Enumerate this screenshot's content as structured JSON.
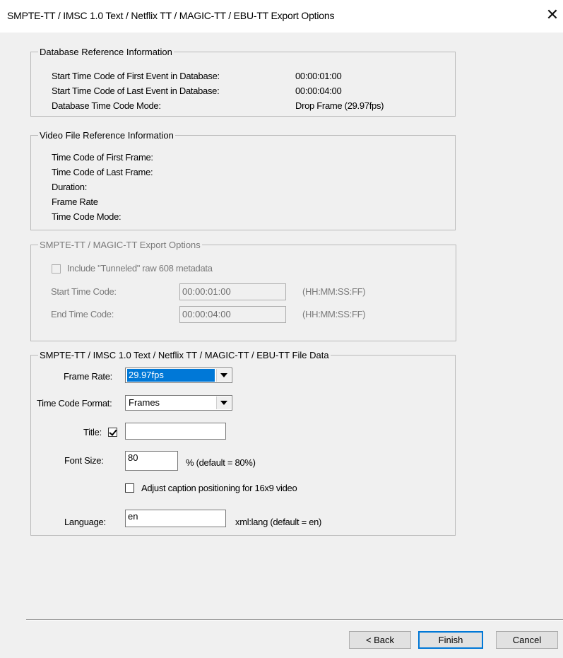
{
  "window": {
    "title": "SMPTE-TT / IMSC 1.0 Text / Netflix TT / MAGIC-TT / EBU-TT Export Options",
    "close_glyph": "✕"
  },
  "db_ref": {
    "legend": "Database Reference Information",
    "rows": [
      {
        "label": "Start Time Code of First Event in Database:",
        "value": "00:00:01:00"
      },
      {
        "label": "Start Time Code of Last Event in Database:",
        "value": "00:00:04:00"
      },
      {
        "label": "Database Time Code Mode:",
        "value": "Drop Frame (29.97fps)"
      }
    ]
  },
  "video_ref": {
    "legend": "Video File Reference Information",
    "rows": [
      {
        "label": "Time Code of First Frame:",
        "value": ""
      },
      {
        "label": "Time Code of Last Frame:",
        "value": ""
      },
      {
        "label": "Duration:",
        "value": ""
      },
      {
        "label": "Frame Rate",
        "value": ""
      },
      {
        "label": "Time Code Mode:",
        "value": ""
      }
    ]
  },
  "export_opts": {
    "legend": "SMPTE-TT / MAGIC-TT Export Options",
    "tunneled_label": "Include \"Tunneled\" raw 608 metadata",
    "tunneled_checked": false,
    "start_label": "Start Time Code:",
    "start_value": "00:00:01:00",
    "start_hint": "(HH:MM:SS:FF)",
    "end_label": "End Time Code:",
    "end_value": "00:00:04:00",
    "end_hint": "(HH:MM:SS:FF)"
  },
  "file_data": {
    "legend": "SMPTE-TT / IMSC 1.0 Text / Netflix TT / MAGIC-TT / EBU-TT File Data",
    "frame_rate_label": "Frame Rate:",
    "frame_rate_value": "29.97fps",
    "tc_format_label": "Time Code Format:",
    "tc_format_value": "Frames",
    "title_label": "Title:",
    "title_checked": true,
    "title_value": "",
    "font_size_label": "Font Size:",
    "font_size_value": "80",
    "font_size_hint": "%  (default = 80%)",
    "adjust_label": "Adjust caption positioning for 16x9 video",
    "adjust_checked": false,
    "language_label": "Language:",
    "language_value": "en",
    "language_hint": "xml:lang  (default = en)"
  },
  "buttons": {
    "back": "< Back",
    "finish": "Finish",
    "cancel": "Cancel"
  },
  "colors": {
    "selection": "#0078d7",
    "dialog_bg": "#f0f0f0",
    "disabled_text": "#7a7a7a"
  }
}
